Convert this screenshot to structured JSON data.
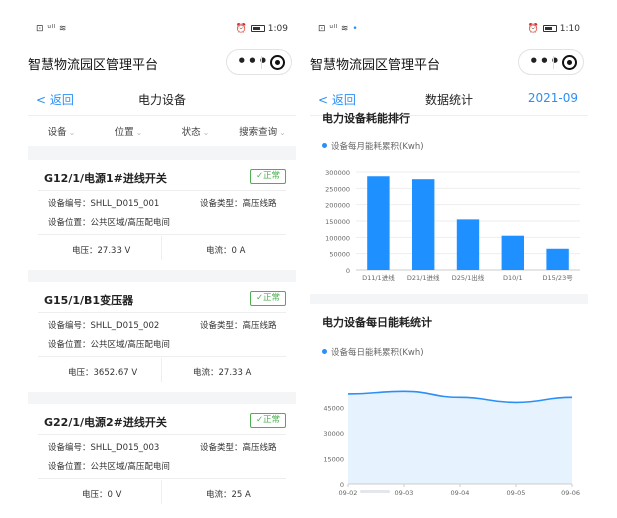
{
  "status_left": {
    "signal": "⊡ ᵘˡˡ ≋",
    "time": "1:09",
    "dot": ""
  },
  "status_right": {
    "signal": "⊡ ᵘˡˡ ≋",
    "time": "1:10",
    "dot": "•"
  },
  "app_title": "智慧物流园区管理平台",
  "capsule": {
    "dots": "•••"
  },
  "left": {
    "nav": {
      "back": "< 返回",
      "title": "电力设备"
    },
    "filters": [
      "设备",
      "位置",
      "状态",
      "搜索查询"
    ],
    "cards": [
      {
        "title": "G12/1/电源1#进线开关",
        "status": "✓正常",
        "code_label": "设备编号：",
        "code": "SHLL_D015_001",
        "type_label": "设备类型：",
        "type": "高压线路",
        "loc_label": "设备位置：",
        "loc": "公共区域/高压配电间",
        "volt_label": "电压：",
        "volt": "27.33 V",
        "cur_label": "电流：",
        "cur": "0 A"
      },
      {
        "title": "G15/1/B1变压器",
        "status": "✓正常",
        "code_label": "设备编号：",
        "code": "SHLL_D015_002",
        "type_label": "设备类型：",
        "type": "高压线路",
        "loc_label": "设备位置：",
        "loc": "公共区域/高压配电间",
        "volt_label": "电压：",
        "volt": "3652.67 V",
        "cur_label": "电流：",
        "cur": "27.33 A"
      },
      {
        "title": "G22/1/电源2#进线开关",
        "status": "✓正常",
        "code_label": "设备编号：",
        "code": "SHLL_D015_003",
        "type_label": "设备类型：",
        "type": "高压线路",
        "loc_label": "设备位置：",
        "loc": "公共区域/高压配电间",
        "volt_label": "电压：",
        "volt": "0 V",
        "cur_label": "电流：",
        "cur": "25 A"
      }
    ]
  },
  "right": {
    "nav": {
      "back": "< 返回",
      "title": "数据统计",
      "month": "2021-09"
    },
    "section1_title": "电力设备耗能排行",
    "section2_title": "电力设备每日能耗统计"
  },
  "colors": {
    "accent": "#2a8ff7",
    "ok": "#4caf50",
    "bar": "#1e90ff",
    "area": "#e6f2fe"
  },
  "chart_data": [
    {
      "type": "bar",
      "legend": "设备每月能耗累积(Kwh)",
      "categories": [
        "D11/1进线",
        "D21/1进线",
        "D25/1出线",
        "D10/1",
        "D15/23号"
      ],
      "values": [
        287000,
        278000,
        155000,
        105000,
        65000
      ],
      "yticks": [
        "300000",
        "250000",
        "200000",
        "150000",
        "100000",
        "50000",
        "0"
      ],
      "ylim": [
        0,
        300000
      ]
    },
    {
      "type": "area",
      "legend": "设备每日能耗累积(Kwh)",
      "x": [
        "09-02",
        "09-03",
        "09-04",
        "09-05",
        "09-06"
      ],
      "values": [
        53000,
        54500,
        51000,
        48000,
        51000
      ],
      "yticks": [
        "45000",
        "30000",
        "15000",
        "0"
      ],
      "ylim": [
        0,
        60000
      ]
    }
  ]
}
